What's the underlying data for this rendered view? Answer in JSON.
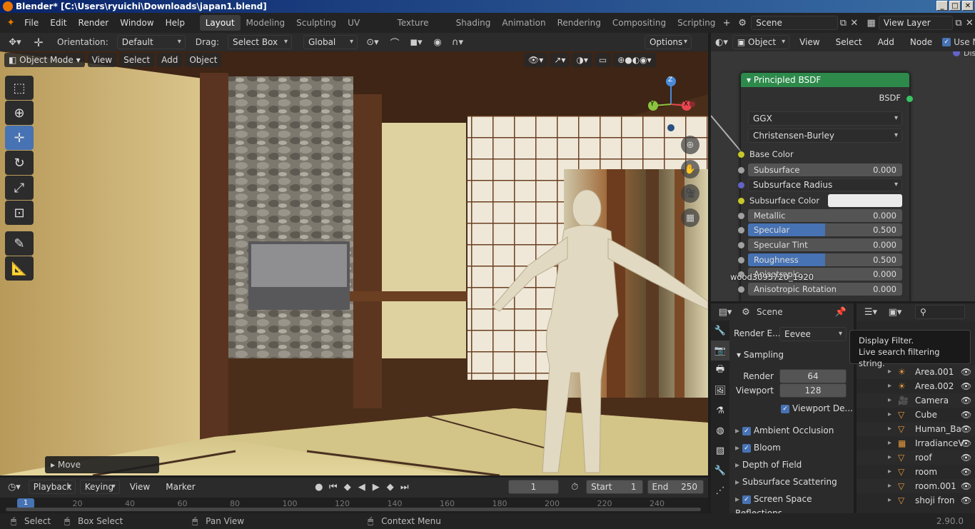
{
  "window": {
    "title": "Blender* [C:\\Users\\ryuichi\\Downloads\\japan1.blend]",
    "controls": [
      "_",
      "□",
      "✕"
    ]
  },
  "menu": {
    "items": [
      "File",
      "Edit",
      "Render",
      "Window",
      "Help"
    ]
  },
  "workspaces": [
    "Layout",
    "Modeling",
    "Sculpting",
    "UV Editing",
    "Texture Paint",
    "Shading",
    "Animation",
    "Rendering",
    "Compositing",
    "Scripting"
  ],
  "active_workspace": "Layout",
  "scene_name": "Scene",
  "view_layer": "View Layer",
  "toolheader": {
    "orientation_label": "Orientation:",
    "orientation_value": "Default",
    "drag_label": "Drag:",
    "drag_value": "Select Box",
    "transform_orientation": "Global",
    "options": "Options"
  },
  "viewport": {
    "mode": "Object Mode",
    "menus": [
      "View",
      "Select",
      "Add",
      "Object"
    ],
    "last_operator": "Move",
    "gizmo_axes": {
      "x": "X",
      "y": "Y",
      "z": "Z"
    }
  },
  "node_editor": {
    "object_type": "Object",
    "menus": [
      "View",
      "Select",
      "Add",
      "Node"
    ],
    "use_nodes_label": "Use Nodes",
    "dangling_text": "Dis",
    "image_label": "wood3095720_1920",
    "bsdf": {
      "title": "Principled BSDF",
      "output": "BSDF",
      "distribution": "GGX",
      "subsurface_method": "Christensen-Burley",
      "inputs": [
        {
          "label": "Base Color",
          "kind": "color-socket",
          "socket": "#c7c729"
        },
        {
          "label": "Subsurface",
          "value": "0.000",
          "fill": 0,
          "socket": "#a1a1a1"
        },
        {
          "label": "Subsurface Radius",
          "kind": "dropdown",
          "socket": "#6363c7"
        },
        {
          "label": "Subsurface Color",
          "kind": "color",
          "socket": "#c7c729"
        },
        {
          "label": "Metallic",
          "value": "0.000",
          "fill": 0,
          "socket": "#a1a1a1"
        },
        {
          "label": "Specular",
          "value": "0.500",
          "fill": 0.5,
          "socket": "#a1a1a1"
        },
        {
          "label": "Specular Tint",
          "value": "0.000",
          "fill": 0,
          "socket": "#a1a1a1"
        },
        {
          "label": "Roughness",
          "value": "0.500",
          "fill": 0.5,
          "socket": "#a1a1a1"
        },
        {
          "label": "Anisotropic",
          "value": "0.000",
          "fill": 0,
          "socket": "#a1a1a1"
        },
        {
          "label": "Anisotropic Rotation",
          "value": "0.000",
          "fill": 0,
          "socket": "#a1a1a1"
        }
      ]
    }
  },
  "properties": {
    "scene_label": "Scene",
    "render_engine_label": "Render E...",
    "render_engine": "Eevee",
    "sampling": "Sampling",
    "render_label": "Render",
    "render_samples": "64",
    "viewport_label": "Viewport",
    "viewport_samples": "128",
    "viewport_denoise": "Viewport De...",
    "panels": [
      {
        "label": "Ambient Occlusion",
        "checked": true
      },
      {
        "label": "Bloom",
        "checked": true
      },
      {
        "label": "Depth of Field",
        "checked": null
      },
      {
        "label": "Subsurface Scattering",
        "checked": null
      },
      {
        "label": "Screen Space Reflections",
        "checked": true
      }
    ]
  },
  "outliner": {
    "tooltip_title": "Display Filter.",
    "tooltip_body": "Live search filtering string.",
    "items": [
      {
        "name": "Area.001",
        "icon": "light-icon"
      },
      {
        "name": "Area.002",
        "icon": "light-icon"
      },
      {
        "name": "Camera",
        "icon": "camera-icon"
      },
      {
        "name": "Cube",
        "icon": "mesh-icon"
      },
      {
        "name": "Human_Ba",
        "icon": "mesh-icon"
      },
      {
        "name": "IrradianceV",
        "icon": "probe-icon"
      },
      {
        "name": "roof",
        "icon": "mesh-icon"
      },
      {
        "name": "room",
        "icon": "mesh-icon"
      },
      {
        "name": "room.001",
        "icon": "mesh-icon"
      },
      {
        "name": "shoji fron",
        "icon": "mesh-icon"
      }
    ]
  },
  "timeline": {
    "menus": [
      "Playback",
      "Keying",
      "View",
      "Marker"
    ],
    "current_frame": "1",
    "start_label": "Start",
    "start": "1",
    "end_label": "End",
    "end": "250",
    "ticks": [
      "0",
      "20",
      "40",
      "60",
      "80",
      "100",
      "120",
      "140",
      "160",
      "180",
      "200",
      "220",
      "240"
    ]
  },
  "statusbar": {
    "select": "Select",
    "box_select": "Box Select",
    "pan_view": "Pan View",
    "context_menu": "Context Menu",
    "version": "2.90.0"
  },
  "colors": {
    "accent": "#4772b3",
    "node_header": "#2d8a4b",
    "x_axis": "#e8464f",
    "y_axis": "#8bc43e",
    "z_axis": "#4a8ad8"
  }
}
